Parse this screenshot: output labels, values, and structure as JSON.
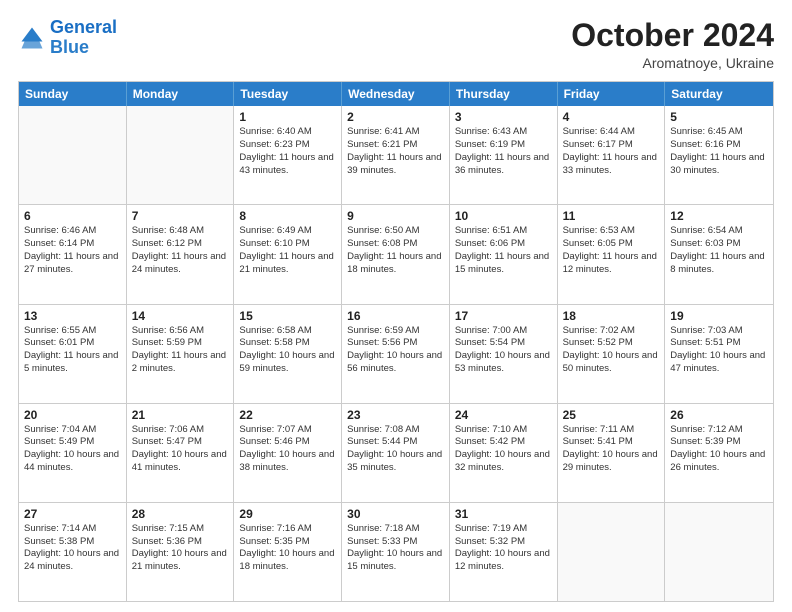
{
  "header": {
    "logo_line1": "General",
    "logo_line2": "Blue",
    "month_year": "October 2024",
    "location": "Aromatnoye, Ukraine"
  },
  "days_of_week": [
    "Sunday",
    "Monday",
    "Tuesday",
    "Wednesday",
    "Thursday",
    "Friday",
    "Saturday"
  ],
  "weeks": [
    [
      {
        "day": "",
        "text": ""
      },
      {
        "day": "",
        "text": ""
      },
      {
        "day": "1",
        "text": "Sunrise: 6:40 AM\nSunset: 6:23 PM\nDaylight: 11 hours and 43 minutes."
      },
      {
        "day": "2",
        "text": "Sunrise: 6:41 AM\nSunset: 6:21 PM\nDaylight: 11 hours and 39 minutes."
      },
      {
        "day": "3",
        "text": "Sunrise: 6:43 AM\nSunset: 6:19 PM\nDaylight: 11 hours and 36 minutes."
      },
      {
        "day": "4",
        "text": "Sunrise: 6:44 AM\nSunset: 6:17 PM\nDaylight: 11 hours and 33 minutes."
      },
      {
        "day": "5",
        "text": "Sunrise: 6:45 AM\nSunset: 6:16 PM\nDaylight: 11 hours and 30 minutes."
      }
    ],
    [
      {
        "day": "6",
        "text": "Sunrise: 6:46 AM\nSunset: 6:14 PM\nDaylight: 11 hours and 27 minutes."
      },
      {
        "day": "7",
        "text": "Sunrise: 6:48 AM\nSunset: 6:12 PM\nDaylight: 11 hours and 24 minutes."
      },
      {
        "day": "8",
        "text": "Sunrise: 6:49 AM\nSunset: 6:10 PM\nDaylight: 11 hours and 21 minutes."
      },
      {
        "day": "9",
        "text": "Sunrise: 6:50 AM\nSunset: 6:08 PM\nDaylight: 11 hours and 18 minutes."
      },
      {
        "day": "10",
        "text": "Sunrise: 6:51 AM\nSunset: 6:06 PM\nDaylight: 11 hours and 15 minutes."
      },
      {
        "day": "11",
        "text": "Sunrise: 6:53 AM\nSunset: 6:05 PM\nDaylight: 11 hours and 12 minutes."
      },
      {
        "day": "12",
        "text": "Sunrise: 6:54 AM\nSunset: 6:03 PM\nDaylight: 11 hours and 8 minutes."
      }
    ],
    [
      {
        "day": "13",
        "text": "Sunrise: 6:55 AM\nSunset: 6:01 PM\nDaylight: 11 hours and 5 minutes."
      },
      {
        "day": "14",
        "text": "Sunrise: 6:56 AM\nSunset: 5:59 PM\nDaylight: 11 hours and 2 minutes."
      },
      {
        "day": "15",
        "text": "Sunrise: 6:58 AM\nSunset: 5:58 PM\nDaylight: 10 hours and 59 minutes."
      },
      {
        "day": "16",
        "text": "Sunrise: 6:59 AM\nSunset: 5:56 PM\nDaylight: 10 hours and 56 minutes."
      },
      {
        "day": "17",
        "text": "Sunrise: 7:00 AM\nSunset: 5:54 PM\nDaylight: 10 hours and 53 minutes."
      },
      {
        "day": "18",
        "text": "Sunrise: 7:02 AM\nSunset: 5:52 PM\nDaylight: 10 hours and 50 minutes."
      },
      {
        "day": "19",
        "text": "Sunrise: 7:03 AM\nSunset: 5:51 PM\nDaylight: 10 hours and 47 minutes."
      }
    ],
    [
      {
        "day": "20",
        "text": "Sunrise: 7:04 AM\nSunset: 5:49 PM\nDaylight: 10 hours and 44 minutes."
      },
      {
        "day": "21",
        "text": "Sunrise: 7:06 AM\nSunset: 5:47 PM\nDaylight: 10 hours and 41 minutes."
      },
      {
        "day": "22",
        "text": "Sunrise: 7:07 AM\nSunset: 5:46 PM\nDaylight: 10 hours and 38 minutes."
      },
      {
        "day": "23",
        "text": "Sunrise: 7:08 AM\nSunset: 5:44 PM\nDaylight: 10 hours and 35 minutes."
      },
      {
        "day": "24",
        "text": "Sunrise: 7:10 AM\nSunset: 5:42 PM\nDaylight: 10 hours and 32 minutes."
      },
      {
        "day": "25",
        "text": "Sunrise: 7:11 AM\nSunset: 5:41 PM\nDaylight: 10 hours and 29 minutes."
      },
      {
        "day": "26",
        "text": "Sunrise: 7:12 AM\nSunset: 5:39 PM\nDaylight: 10 hours and 26 minutes."
      }
    ],
    [
      {
        "day": "27",
        "text": "Sunrise: 7:14 AM\nSunset: 5:38 PM\nDaylight: 10 hours and 24 minutes."
      },
      {
        "day": "28",
        "text": "Sunrise: 7:15 AM\nSunset: 5:36 PM\nDaylight: 10 hours and 21 minutes."
      },
      {
        "day": "29",
        "text": "Sunrise: 7:16 AM\nSunset: 5:35 PM\nDaylight: 10 hours and 18 minutes."
      },
      {
        "day": "30",
        "text": "Sunrise: 7:18 AM\nSunset: 5:33 PM\nDaylight: 10 hours and 15 minutes."
      },
      {
        "day": "31",
        "text": "Sunrise: 7:19 AM\nSunset: 5:32 PM\nDaylight: 10 hours and 12 minutes."
      },
      {
        "day": "",
        "text": ""
      },
      {
        "day": "",
        "text": ""
      }
    ]
  ]
}
